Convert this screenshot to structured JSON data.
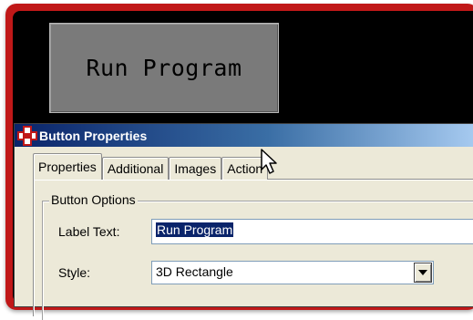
{
  "preview": {
    "button_label": "Run Program"
  },
  "dialog": {
    "title": "Button Properties",
    "tabs": [
      {
        "label": "Properties",
        "active": true
      },
      {
        "label": "Additional",
        "active": false
      },
      {
        "label": "Images",
        "active": false
      },
      {
        "label": "Action",
        "active": false
      }
    ],
    "group": {
      "legend": "Button Options",
      "label_text": {
        "label": "Label Text:",
        "value": "Run Program"
      },
      "style": {
        "label": "Style:",
        "value": "3D Rectangle"
      }
    }
  },
  "colors": {
    "frame": "#c01818",
    "screen": "#000000",
    "preview_button": "#7a7a7a",
    "titlebar_start": "#0a246a",
    "titlebar_end": "#a6caf0",
    "dialog_bg": "#ece9d8",
    "selection": "#0a246a"
  },
  "icons": {
    "title_icon": "app-icon",
    "dropdown": "chevron-down-icon",
    "pointer": "mouse-cursor-icon"
  }
}
